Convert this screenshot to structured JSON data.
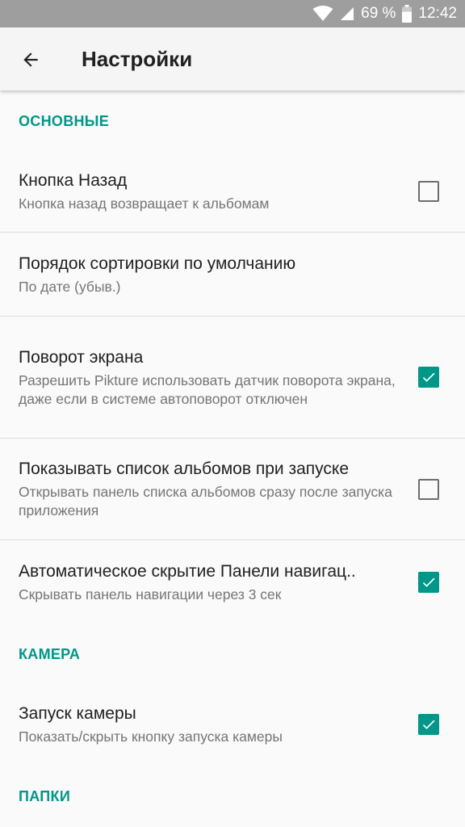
{
  "status_bar": {
    "battery_percent": "69 %",
    "time": "12:42"
  },
  "app_bar": {
    "title": "Настройки",
    "back_icon": "arrow-back-icon"
  },
  "sections": {
    "general": {
      "header": "ОСНОВНЫЕ",
      "items": [
        {
          "title": "Кнопка Назад",
          "summary": "Кнопка назад возвращает к альбомам",
          "checked": false
        },
        {
          "title": "Порядок сортировки по умолчанию",
          "summary": "По дате (убыв.)"
        },
        {
          "title": "Поворот экрана",
          "summary": "Разрешить Pikture использовать датчик поворота экрана, даже если в системе автоповорот отключен",
          "checked": true
        },
        {
          "title": "Показывать список альбомов при запуске",
          "summary": "Открывать панель списка альбомов сразу после запуска приложения",
          "checked": false
        },
        {
          "title": "Автоматическое скрытие Панели навигац..",
          "summary": "Скрывать панель навигации через 3 сек",
          "checked": true
        }
      ]
    },
    "camera": {
      "header": "КАМЕРА",
      "items": [
        {
          "title": "Запуск камеры",
          "summary": "Показать/скрыть кнопку запуска камеры",
          "checked": true
        }
      ]
    },
    "folders": {
      "header": "ПАПКИ"
    }
  },
  "colors": {
    "accent": "#009688",
    "status_bar": "#9e9e9e",
    "app_bar": "#f5f5f5",
    "background": "#fafafa"
  }
}
